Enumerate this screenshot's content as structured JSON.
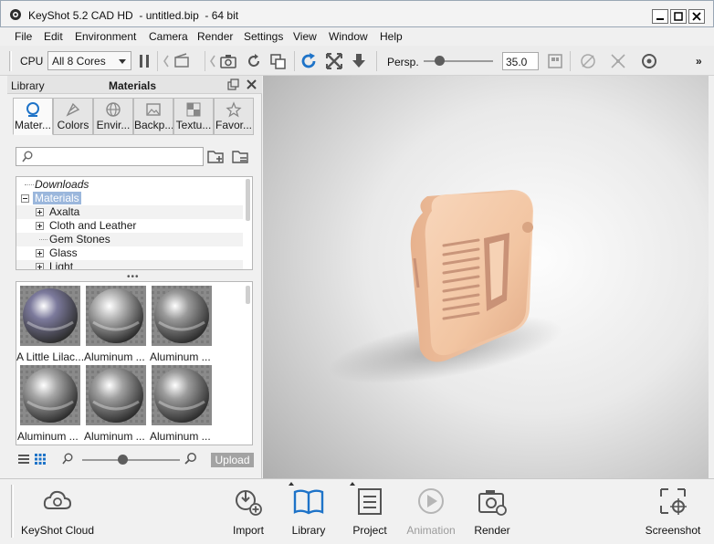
{
  "window": {
    "title": "KeyShot 5.2 CAD HD  - untitled.bip  - 64 bit"
  },
  "menu": [
    "File",
    "Edit",
    "Environment",
    "Camera",
    "Render",
    "Settings",
    "View",
    "Window",
    "Help"
  ],
  "toolbar": {
    "cpu_label": "CPU",
    "cores_value": "All 8 Cores",
    "persp_label": "Persp.",
    "fov_value": "35.0",
    "fov_slider_fraction": 0.22,
    "icons": [
      "pause-icon",
      "movie-icon",
      "screenshot-icon",
      "refresh-icon",
      "scene-icon",
      "reload-blue-icon",
      "fit-icon",
      "drop-icon",
      "render-region-icon",
      "turntable-icon",
      "geometry-icon",
      "perf-icon",
      "overflow-chevron-icon"
    ]
  },
  "library": {
    "panel_title": "Library",
    "header": "Materials",
    "tabs": [
      {
        "label": "Mater...",
        "icon": "materials-icon",
        "active": true
      },
      {
        "label": "Colors",
        "icon": "colors-icon",
        "active": false
      },
      {
        "label": "Envir...",
        "icon": "environments-icon",
        "active": false
      },
      {
        "label": "Backp...",
        "icon": "backplates-icon",
        "active": false
      },
      {
        "label": "Textu...",
        "icon": "textures-icon",
        "active": false
      },
      {
        "label": "Favor...",
        "icon": "favorites-icon",
        "active": false
      }
    ],
    "search_placeholder": "",
    "tree": [
      {
        "label": "Downloads",
        "italic": true,
        "expander": "none",
        "indent": 0
      },
      {
        "label": "Materials",
        "selected": true,
        "expander": "minus",
        "indent": 0
      },
      {
        "label": "Axalta",
        "expander": "plus",
        "indent": 1
      },
      {
        "label": "Cloth and Leather",
        "expander": "plus",
        "indent": 1
      },
      {
        "label": "Gem Stones",
        "expander": "none",
        "indent": 1
      },
      {
        "label": "Glass",
        "expander": "plus",
        "indent": 1
      },
      {
        "label": "Light",
        "expander": "plus",
        "indent": 1
      }
    ],
    "thumbnails": [
      {
        "caption": "A Little Lilac...",
        "color": "#7c7a9c"
      },
      {
        "caption": "Aluminum ...",
        "color": "#b4b4b4"
      },
      {
        "caption": "Aluminum ...",
        "color": "#9a9a9a"
      },
      {
        "caption": "Aluminum ...",
        "color": "#a6a6a6"
      },
      {
        "caption": "Aluminum ...",
        "color": "#a0a0a0"
      },
      {
        "caption": "Aluminum ...",
        "color": "#9c9c9c"
      }
    ],
    "zoom_fraction": 0.34,
    "upload_label": "Upload"
  },
  "bottombar": {
    "cloud": "KeyShot Cloud",
    "import": "Import",
    "library": "Library",
    "project": "Project",
    "animation": "Animation",
    "render": "Render",
    "screenshot": "Screenshot"
  },
  "colors": {
    "accent_blue": "#1e73c8",
    "selection": "#9bb7dc",
    "part_color": "#f2c7a6"
  }
}
